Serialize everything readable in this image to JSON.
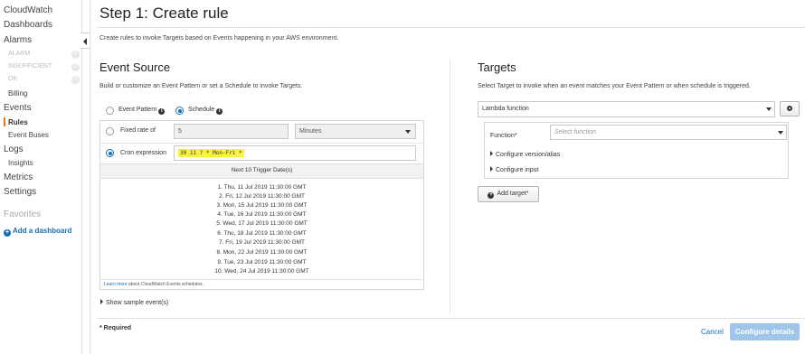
{
  "sidebar": {
    "cloudwatch": "CloudWatch",
    "dashboards": "Dashboards",
    "alarms": "Alarms",
    "alarm_states": [
      {
        "label": "ALARM",
        "count": "0"
      },
      {
        "label": "INSUFFICIENT",
        "count": "0"
      },
      {
        "label": "OK",
        "count": "0"
      }
    ],
    "billing": "Billing",
    "events": "Events",
    "rules": "Rules",
    "event_buses": "Event Buses",
    "logs": "Logs",
    "insights": "Insights",
    "metrics": "Metrics",
    "settings": "Settings",
    "favorites": "Favorites",
    "add_dashboard": "Add a dashboard"
  },
  "page": {
    "title": "Step 1: Create rule",
    "description": "Create rules to invoke Targets based on Events happening in your AWS environment."
  },
  "event_source": {
    "heading": "Event Source",
    "description": "Build or customize an Event Pattern or set a Schedule to invoke Targets.",
    "event_pattern_label": "Event Pattern",
    "schedule_label": "Schedule",
    "info_glyph": "i",
    "fixed_rate_label": "Fixed rate of",
    "fixed_rate_value": "5",
    "fixed_rate_unit": "Minutes",
    "cron_label": "Cron expression",
    "cron_value": "30 11 ? * Mon-Fri *",
    "next_dates_heading": "Next 10 Trigger Date(s)",
    "next_dates": [
      "1. Thu, 11 Jul 2019 11:30:00 GMT",
      "2. Fri, 12 Jul 2019 11:30:00 GMT",
      "3. Mon, 15 Jul 2019 11:30:00 GMT",
      "4. Tue, 16 Jul 2019 11:30:00 GMT",
      "5. Wed, 17 Jul 2019 11:30:00 GMT",
      "6. Thu, 18 Jul 2019 11:30:00 GMT",
      "7. Fri, 19 Jul 2019 11:30:00 GMT",
      "8. Mon, 22 Jul 2019 11:30:00 GMT",
      "9. Tue, 23 Jul 2019 11:30:00 GMT",
      "10. Wed, 24 Jul 2019 11:30:00 GMT"
    ],
    "learn_more_link": "Learn more",
    "learn_more_suffix": " about CloudWatch Events schedules.",
    "show_sample": "Show sample event(s)"
  },
  "targets": {
    "heading": "Targets",
    "description": "Select Target to invoke when an event matches your Event Pattern or when schedule is triggered.",
    "target_type": "Lambda function",
    "function_label": "Function*",
    "function_placeholder": "Select function",
    "configure_version": "Configure version/alias",
    "configure_input": "Configure input",
    "add_target": "Add target*",
    "plus_glyph": "+"
  },
  "footer": {
    "required": "* Required",
    "cancel": "Cancel",
    "configure_details": "Configure details"
  },
  "colors": {
    "accent": "#146eb4",
    "active_marker": "#ec7211",
    "cron_highlight": "#f7f33f",
    "primary_disabled": "#9fc5e8"
  }
}
